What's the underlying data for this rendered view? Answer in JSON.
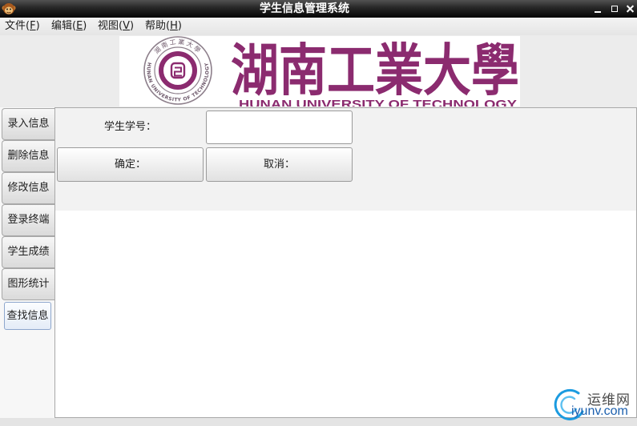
{
  "window": {
    "title": "学生信息管理系统"
  },
  "menu": {
    "items": [
      {
        "prefix": "文件(",
        "mnemonic": "F",
        "suffix": ")"
      },
      {
        "prefix": "编辑(",
        "mnemonic": "E",
        "suffix": ")"
      },
      {
        "prefix": "视图(",
        "mnemonic": "V",
        "suffix": ")"
      },
      {
        "prefix": "帮助(",
        "mnemonic": "H",
        "suffix": ")"
      }
    ]
  },
  "banner": {
    "seal_top_text": "湖南工業大學",
    "seal_ring_text": "HUNAN UNIVERSITY OF TECHNOLOGY",
    "calligraphy": "湖南工業大學",
    "english_name": "HUNAN UNIVERSITY OF TECHNOLOGY"
  },
  "tabs": {
    "selected": 6,
    "items": [
      {
        "label": "录入信息"
      },
      {
        "label": "删除信息"
      },
      {
        "label": "修改信息"
      },
      {
        "label": "登录终端"
      },
      {
        "label": "学生成绩"
      },
      {
        "label": "图形统计"
      },
      {
        "label": "查找信息"
      }
    ]
  },
  "search_form": {
    "id_label": "学生学号：",
    "id_value": "",
    "confirm_label": "确定：",
    "cancel_label": "取消："
  },
  "watermark": {
    "name": "运维网",
    "url": "iyunv.com"
  },
  "icons": {
    "app": "monkey-icon",
    "minimize": "minimize-icon",
    "maximize": "maximize-icon",
    "close": "close-icon",
    "watermark": "swirl-logo-icon"
  },
  "colors": {
    "titlebar": "#000000",
    "brand_purple": "#8b2b6f",
    "selected_tab_border": "#8ea7cd",
    "watermark_blue": "#1b9be0",
    "watermark_url": "#1b5fae"
  }
}
